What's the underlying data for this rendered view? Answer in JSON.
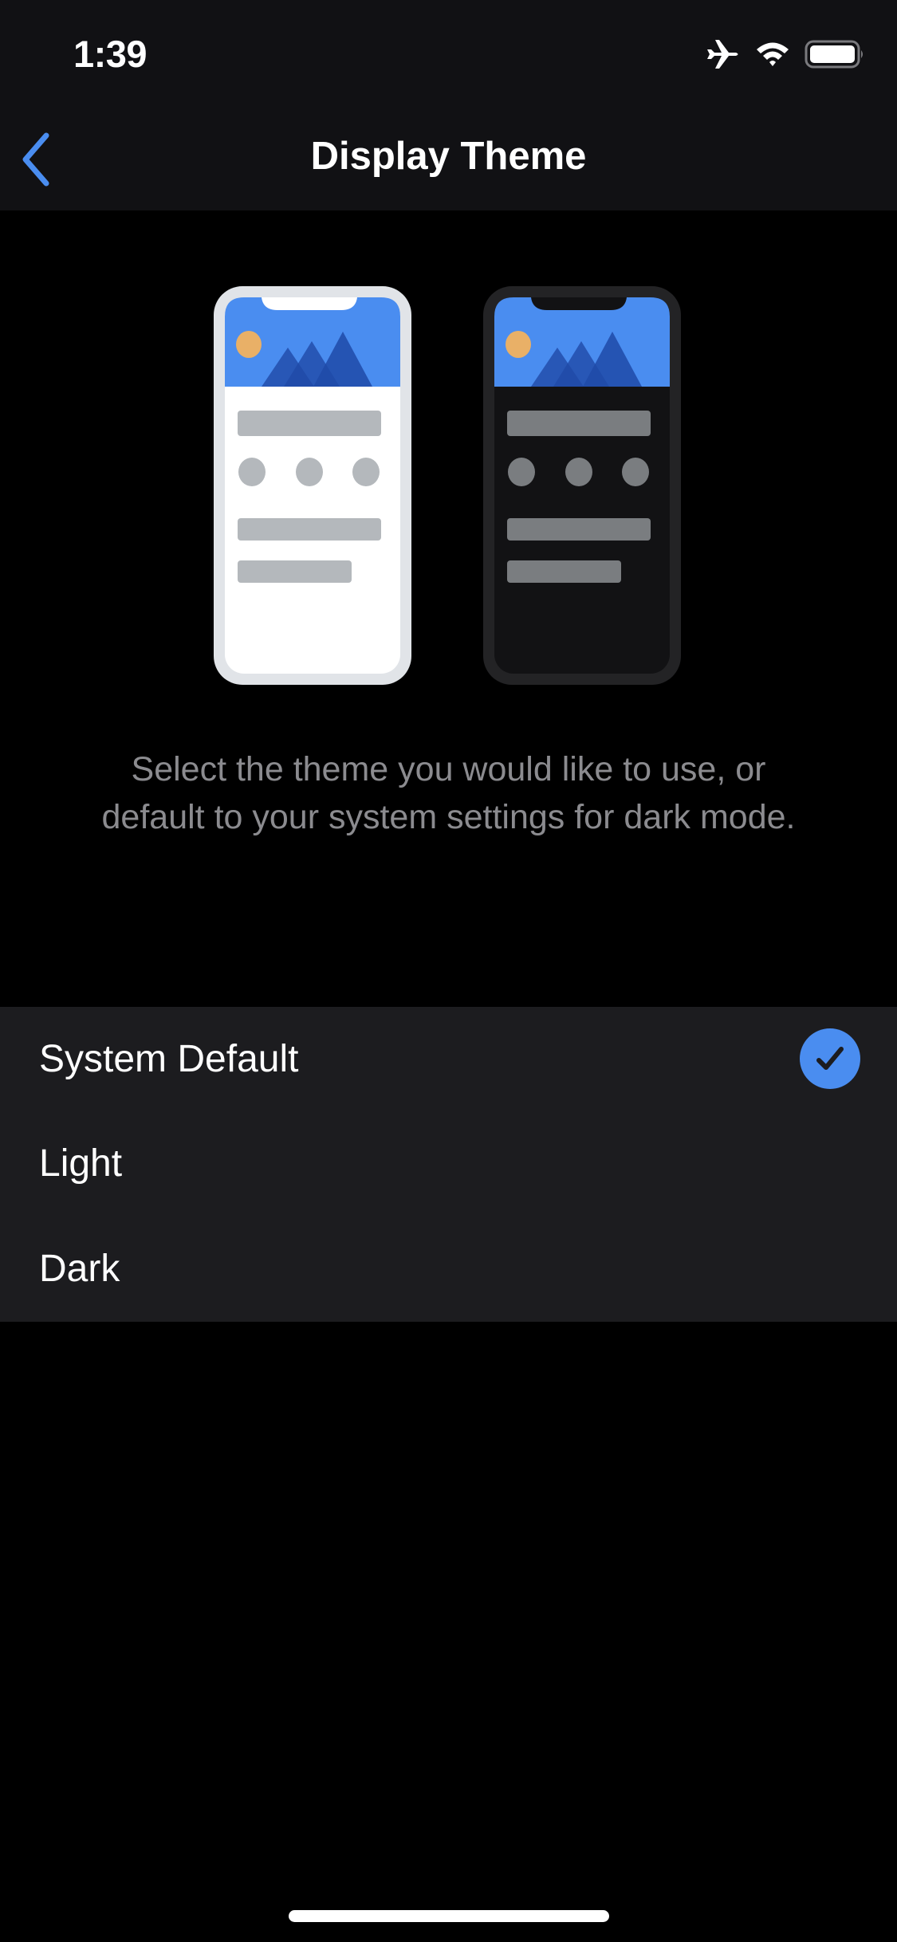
{
  "status_bar": {
    "time": "1:39",
    "icons": [
      "airplane-mode-icon",
      "wifi-icon",
      "battery-icon"
    ]
  },
  "nav": {
    "back_icon": "chevron-left-icon",
    "title": "Display Theme"
  },
  "illustration": {
    "light_preview": "light-theme-phone",
    "dark_preview": "dark-theme-phone"
  },
  "description": "Select the theme you would like to use, or default to your system settings for dark mode.",
  "options": [
    {
      "label": "System Default",
      "selected": true
    },
    {
      "label": "Light",
      "selected": false
    },
    {
      "label": "Dark",
      "selected": false
    }
  ],
  "colors": {
    "accent": "#4a8df0",
    "background": "#000000",
    "bar_background": "#111114",
    "list_background": "#1c1c1f",
    "secondary_text": "#8b8b8f"
  }
}
